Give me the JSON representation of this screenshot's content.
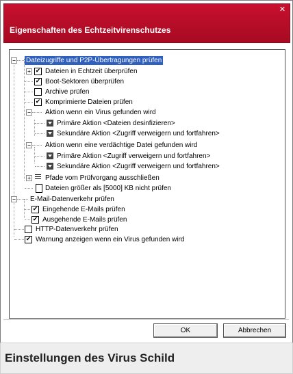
{
  "window": {
    "title": "Eigenschaften des Echtzeitvirenschutzes",
    "close_icon": "close-icon"
  },
  "tree": {
    "items": [
      {
        "label": "Dateizugriffe und P2P-Übertragungen prüfen",
        "state": "group",
        "expanded": true
      },
      {
        "label": "Dateien in Echtzeit überprüfen",
        "state": "checked",
        "expanded": false
      },
      {
        "label": "Boot-Sektoren überprüfen",
        "state": "checked"
      },
      {
        "label": "Archive prüfen",
        "state": "unchecked"
      },
      {
        "label": "Komprimierte Dateien prüfen",
        "state": "checked"
      },
      {
        "label": "Aktion wenn ein Virus gefunden wird",
        "state": "group",
        "expanded": true
      },
      {
        "label": "Primäre Aktion <Dateien desinfizieren>",
        "state": "dropdown"
      },
      {
        "label": "Sekundäre Aktion <Zugriff verweigern und fortfahren>",
        "state": "dropdown"
      },
      {
        "label": "Aktion wenn eine verdächtige Datei gefunden wird",
        "state": "group",
        "expanded": true
      },
      {
        "label": "Primäre Aktion <Zugriff verweigern und fortfahren>",
        "state": "dropdown"
      },
      {
        "label": "Sekundäre Aktion <Zugriff verweigern und fortfahren>",
        "state": "dropdown"
      },
      {
        "label": "Pfade vom Prüfvorgang ausschließen",
        "state": "list",
        "expanded": false
      },
      {
        "label": "Dateien größer als [5000] KB nicht prüfen",
        "state": "file"
      },
      {
        "label": "E-Mail-Datenverkehr prüfen",
        "state": "group",
        "expanded": true
      },
      {
        "label": "Eingehende E-Mails prüfen",
        "state": "checked"
      },
      {
        "label": "Ausgehende E-Mails prüfen",
        "state": "checked"
      },
      {
        "label": "HTTP-Datenverkehr prüfen",
        "state": "unchecked"
      },
      {
        "label": "Warnung anzeigen wenn ein Virus gefunden wird",
        "state": "checked"
      }
    ]
  },
  "buttons": {
    "ok": "OK",
    "cancel": "Abbrechen"
  },
  "caption": "Einstellungen des Virus Schild",
  "colors": {
    "titlebar": "#c8102e",
    "selection": "#2f5fbf"
  }
}
